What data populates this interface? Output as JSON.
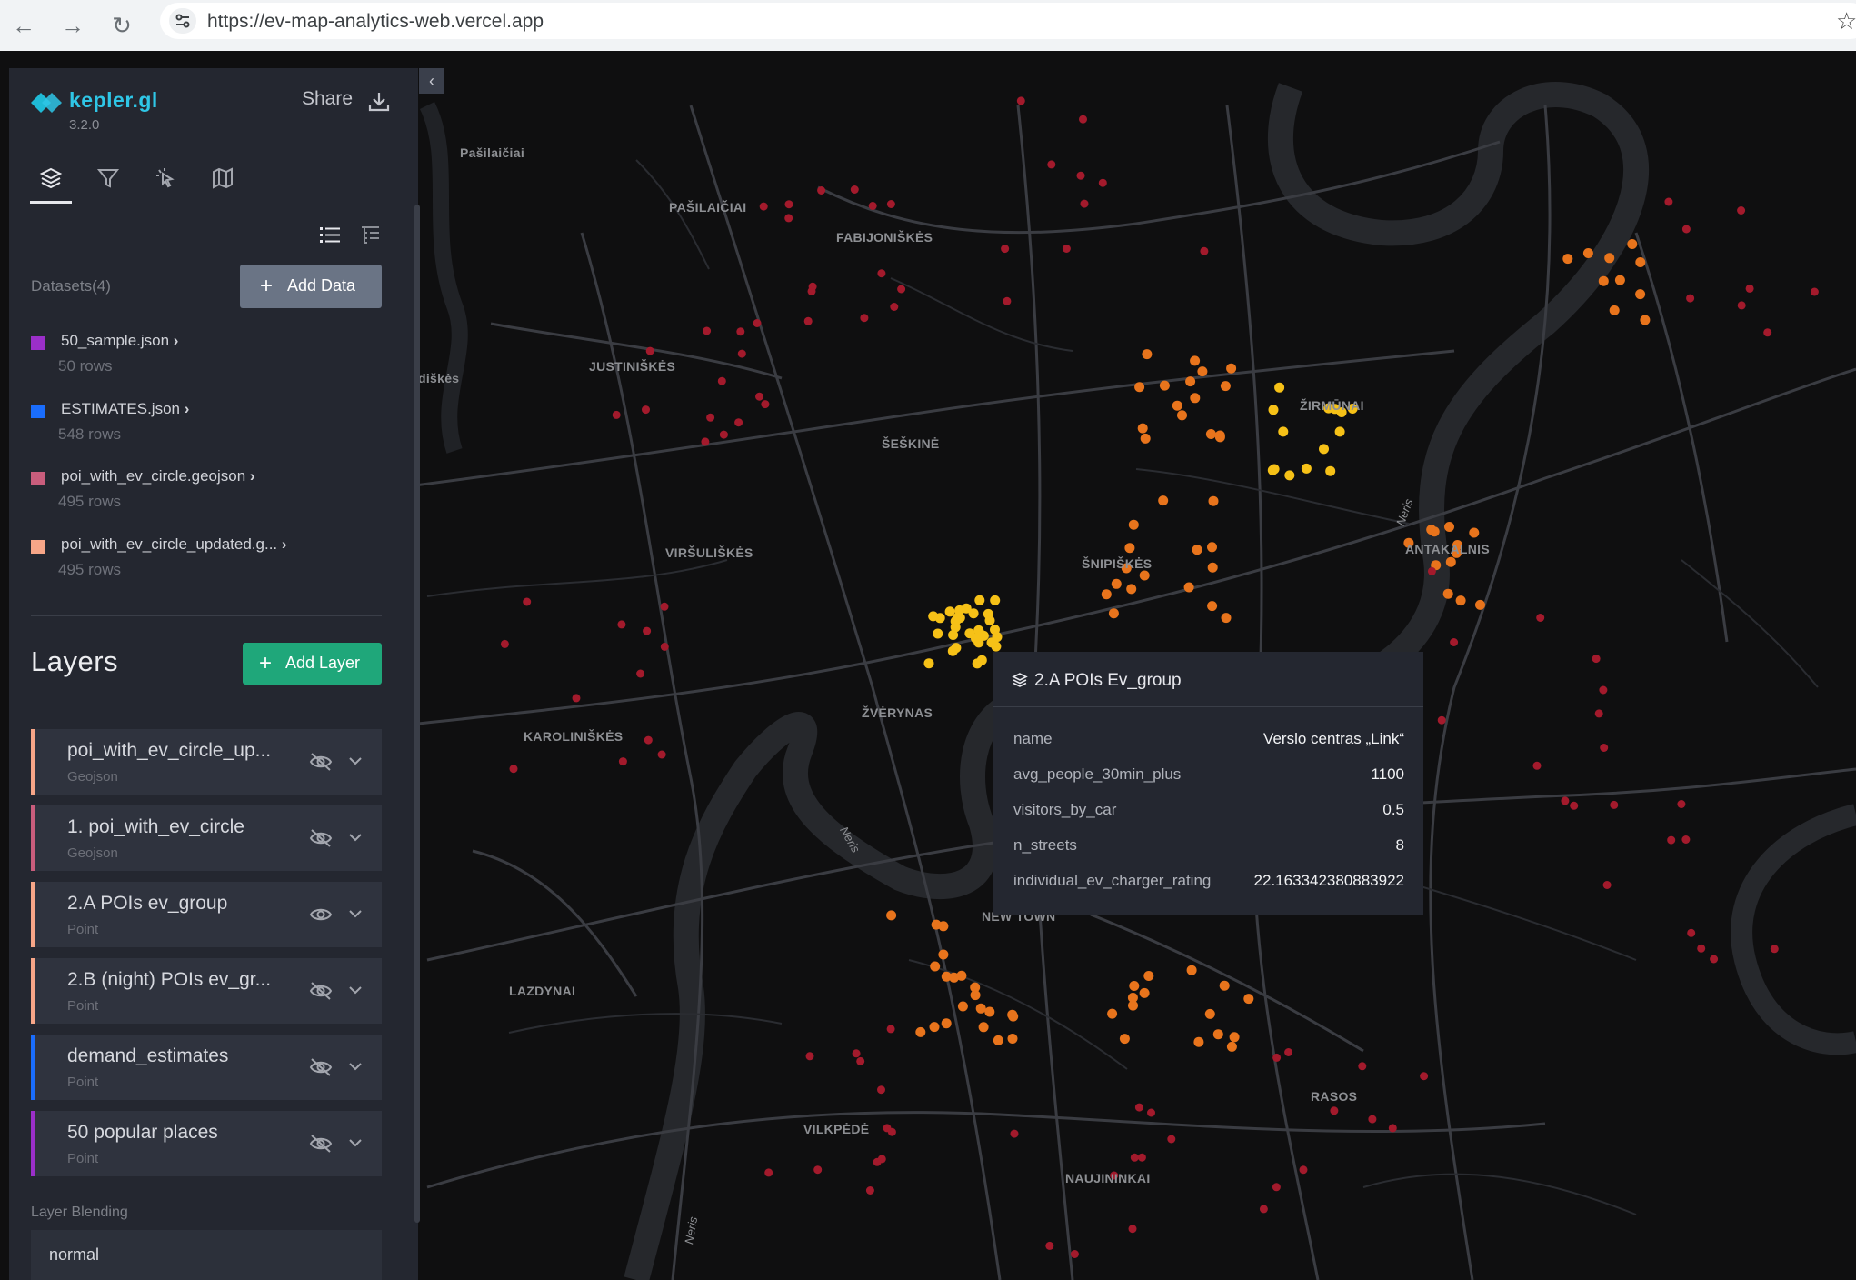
{
  "browser": {
    "url": "https://ev-map-analytics-web.vercel.app",
    "back_icon": "arrow-left-icon",
    "forward_icon": "arrow-right-icon",
    "reload_icon": "reload-icon"
  },
  "app": {
    "name": "kepler.gl",
    "version": "3.2.0",
    "share_label": "Share",
    "accent_color": "#2fc6e6"
  },
  "tabs": [
    {
      "icon": "layers-icon",
      "active": true
    },
    {
      "icon": "filter-icon",
      "active": false
    },
    {
      "icon": "interactions-icon",
      "active": false
    },
    {
      "icon": "basemap-icon",
      "active": false
    }
  ],
  "datasets": {
    "label": "Datasets(4)",
    "add_label": "Add Data",
    "items": [
      {
        "name": "50_sample.json",
        "rows": "50 rows",
        "color": "#9b2fc9"
      },
      {
        "name": "ESTIMATES.json",
        "rows": "548 rows",
        "color": "#1a6dfc"
      },
      {
        "name": "poi_with_ev_circle.geojson",
        "rows": "495 rows",
        "color": "#c95d7c"
      },
      {
        "name": "poi_with_ev_circle_updated.g...",
        "rows": "495 rows",
        "color": "#f7a688"
      }
    ]
  },
  "layers": {
    "title": "Layers",
    "add_label": "Add Layer",
    "items": [
      {
        "name": "poi_with_ev_circle_up...",
        "type": "Geojson",
        "color": "#f7a688",
        "visible": false
      },
      {
        "name": "1. poi_with_ev_circle",
        "type": "Geojson",
        "color": "#c95d7c",
        "visible": false
      },
      {
        "name": "2.A POIs ev_group",
        "type": "Point",
        "color": "#f7a688",
        "visible": true
      },
      {
        "name": "2.B (night) POIs ev_gr...",
        "type": "Point",
        "color": "#f7a688",
        "visible": false
      },
      {
        "name": "demand_estimates",
        "type": "Point",
        "color": "#1a6dfc",
        "visible": false
      },
      {
        "name": "50 popular places",
        "type": "Point",
        "color": "#9b2fc9",
        "visible": false
      }
    ],
    "blending_label": "Layer Blending",
    "blending_value": "normal"
  },
  "tooltip": {
    "title": "2.A POIs Ev_group",
    "rows": [
      {
        "key": "name",
        "value": "Verslo centras „Link“"
      },
      {
        "key": "avg_people_30min_plus",
        "value": "1100"
      },
      {
        "key": "visitors_by_car",
        "value": "0.5"
      },
      {
        "key": "n_streets",
        "value": "8"
      },
      {
        "key": "individual_ev_charger_rating",
        "value": "22.163342380883922"
      }
    ]
  },
  "map": {
    "labels": {
      "pasilaiciai_top": "Pašilaičiai",
      "pasilaiciai": "PAŠILAIČIAI",
      "fabijoniskes": "FABIJONIŠKĖS",
      "justiniskes": "JUSTINIŠKĖS",
      "diskes": "diškės",
      "seskine": "ŠEŠKINĖ",
      "zirmunai": "ŽIRMŪNAI",
      "virsuliskes": "VIRŠULIŠKĖS",
      "snipiskes": "ŠNIPIŠKĖS",
      "antakalnis": "ANTAKALNIS",
      "karoliniskes": "KAROLINIŠKĖS",
      "zverynas": "ŽVĖRYNAS",
      "lazdynai": "LAZDYNAI",
      "naujamiestis": "NEW TOWN",
      "vilkpede": "VILKPĖDĖ",
      "rasos": "RASOS",
      "naujininkai": "NAUJININKAI",
      "neris1": "Neris",
      "neris2": "Neris",
      "neris3": "Neris"
    },
    "background": "#0f0f10",
    "point_colors": {
      "yellow": "#f6c117",
      "orange": "#e8741c",
      "red": "#a31a2c"
    }
  }
}
